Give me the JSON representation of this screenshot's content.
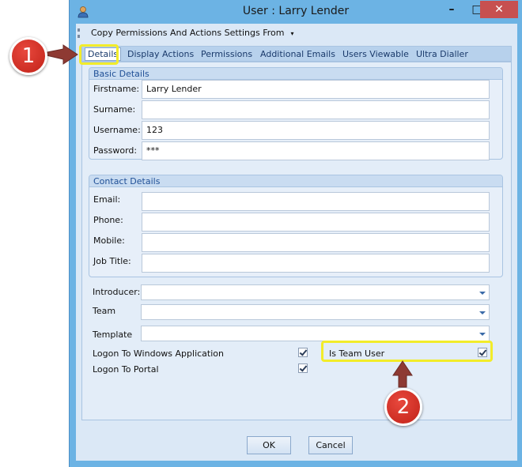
{
  "window": {
    "title": "User : Larry Lender",
    "minimize_glyph": "–",
    "maximize_glyph": "□",
    "close_glyph": "✕"
  },
  "menu": {
    "copy_label": "Copy Permissions And Actions Settings From",
    "arrow": "▾"
  },
  "tabs": [
    {
      "label": "Details"
    },
    {
      "label": "Display Actions"
    },
    {
      "label": "Permissions"
    },
    {
      "label": "Additional Emails"
    },
    {
      "label": "Users Viewable"
    },
    {
      "label": "Ultra Dialler"
    }
  ],
  "basic_details": {
    "heading": "Basic Details",
    "firstname": {
      "label": "Firstname:",
      "value": "Larry Lender"
    },
    "surname": {
      "label": "Surname:",
      "value": ""
    },
    "username": {
      "label": "Username:",
      "value": "123"
    },
    "password": {
      "label": "Password:",
      "value": "***"
    }
  },
  "contact_details": {
    "heading": "Contact Details",
    "email": {
      "label": "Email:",
      "value": ""
    },
    "phone": {
      "label": "Phone:",
      "value": ""
    },
    "mobile": {
      "label": "Mobile:",
      "value": ""
    },
    "job_title": {
      "label": "Job Title:",
      "value": ""
    }
  },
  "other": {
    "introducer": {
      "label": "Introducer:",
      "value": ""
    },
    "team": {
      "label": "Team",
      "value": ""
    },
    "template": {
      "label": "Template",
      "value": ""
    },
    "logon_windows": {
      "label": "Logon To Windows Application",
      "checked": true
    },
    "logon_portal": {
      "label": "Logon To Portal",
      "checked": true
    },
    "is_team_user": {
      "label": "Is Team User",
      "checked": true
    }
  },
  "buttons": {
    "ok": "OK",
    "cancel": "Cancel"
  },
  "annotations": {
    "callout_1": "1",
    "callout_2": "2",
    "highlight_color": "#f2ec2a",
    "callout_color": "#c12218",
    "arrow_color": "#8e3a33"
  }
}
